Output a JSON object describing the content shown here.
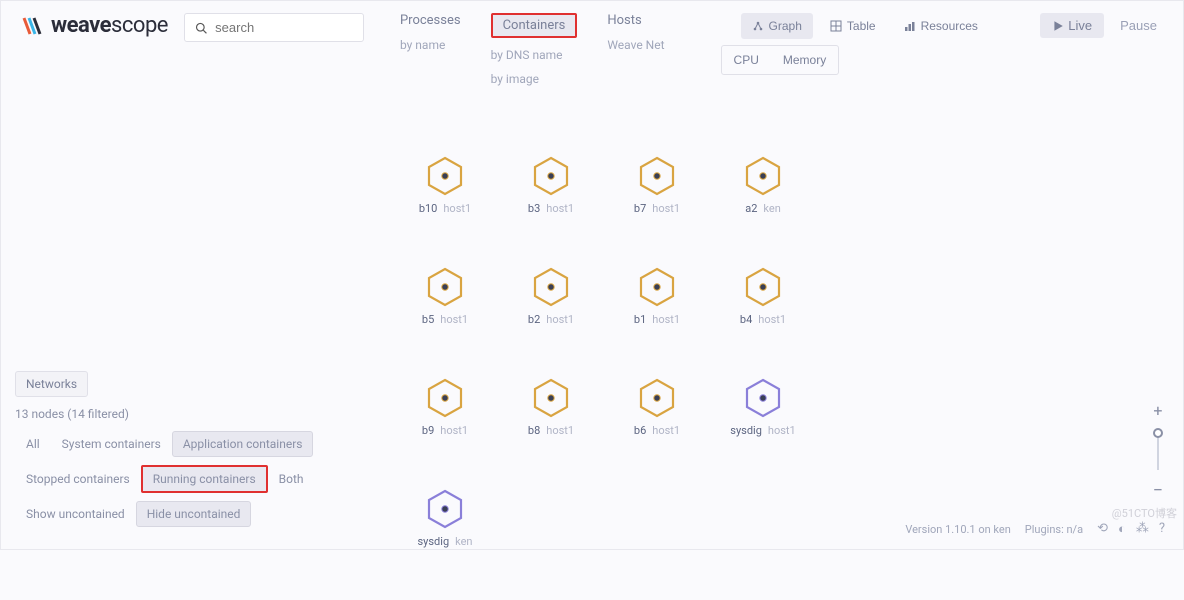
{
  "brand": {
    "strong": "weave",
    "light": "scope"
  },
  "search": {
    "placeholder": "search"
  },
  "nav": {
    "processes": {
      "label": "Processes",
      "subs": [
        "by name"
      ]
    },
    "containers": {
      "label": "Containers",
      "subs": [
        "by DNS name",
        "by image"
      ]
    },
    "hosts": {
      "label": "Hosts",
      "subs": [
        "Weave Net"
      ]
    }
  },
  "views": {
    "graph": "Graph",
    "table": "Table",
    "resources": "Resources"
  },
  "metrics": {
    "cpu": "CPU",
    "memory": "Memory"
  },
  "live": {
    "live": "Live",
    "pause": "Pause"
  },
  "nodes": [
    [
      {
        "name": "b10",
        "host": "host1",
        "color": "#d9a441"
      },
      {
        "name": "b3",
        "host": "host1",
        "color": "#d9a441"
      },
      {
        "name": "b7",
        "host": "host1",
        "color": "#d9a441"
      },
      {
        "name": "a2",
        "host": "ken",
        "color": "#d9a441"
      }
    ],
    [
      {
        "name": "b5",
        "host": "host1",
        "color": "#d9a441"
      },
      {
        "name": "b2",
        "host": "host1",
        "color": "#d9a441"
      },
      {
        "name": "b1",
        "host": "host1",
        "color": "#d9a441"
      },
      {
        "name": "b4",
        "host": "host1",
        "color": "#d9a441"
      }
    ],
    [
      {
        "name": "b9",
        "host": "host1",
        "color": "#d9a441"
      },
      {
        "name": "b8",
        "host": "host1",
        "color": "#d9a441"
      },
      {
        "name": "b6",
        "host": "host1",
        "color": "#d9a441"
      },
      {
        "name": "sysdig",
        "host": "host1",
        "color": "#8a7fd9"
      }
    ],
    [
      {
        "name": "sysdig",
        "host": "ken",
        "color": "#8a7fd9"
      }
    ]
  ],
  "panel": {
    "networks": "Networks",
    "status": "13 nodes (14 filtered)",
    "row1": {
      "all": "All",
      "system": "System containers",
      "app": "Application containers"
    },
    "row2": {
      "stopped": "Stopped containers",
      "running": "Running containers",
      "both": "Both"
    },
    "row3": {
      "show": "Show uncontained",
      "hide": "Hide uncontained"
    }
  },
  "footer": {
    "version": "Version 1.10.1 on ken",
    "plugins": "Plugins: n/a"
  },
  "watermark": "@51CTO博客"
}
